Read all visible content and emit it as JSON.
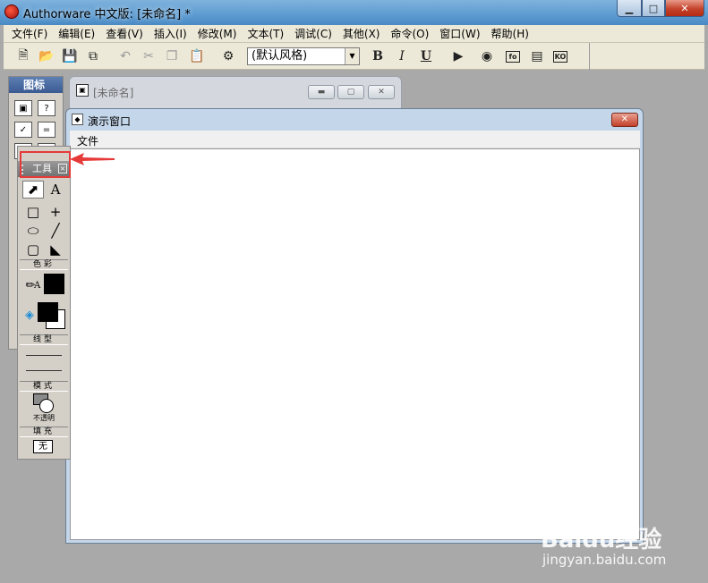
{
  "window": {
    "title": "Authorware 中文版: [未命名] *",
    "min_glyph": "▁",
    "max_glyph": "□",
    "close_glyph": "✕"
  },
  "menubar": {
    "items": [
      "文件(F)",
      "编辑(E)",
      "查看(V)",
      "插入(I)",
      "修改(M)",
      "文本(T)",
      "调试(C)",
      "其他(X)",
      "命令(O)",
      "窗口(W)",
      "帮助(H)"
    ]
  },
  "toolbar": {
    "style_select_value": "(默认风格)",
    "bold_label": "B",
    "italic_label": "I",
    "underline_label": "U",
    "fn_label": "fo",
    "ko_label": "KO"
  },
  "icons_palette": {
    "title": "图标"
  },
  "flowline_window": {
    "title": "[未命名]"
  },
  "presentation_window": {
    "title": "演示窗口",
    "menu_file": "文件"
  },
  "tools_palette": {
    "title": "工具",
    "sections": {
      "color": "色彩",
      "line": "线型",
      "mode": "模式",
      "fill": "填充"
    },
    "mode_value": "不透明",
    "fill_value": "无",
    "text_tool_label": "A"
  },
  "watermark": {
    "brand": "Baidu经验",
    "url": "jingyan.baidu.com"
  },
  "colors": {
    "highlight": "#e63a3a",
    "title_blue": "#5c9bd1"
  }
}
